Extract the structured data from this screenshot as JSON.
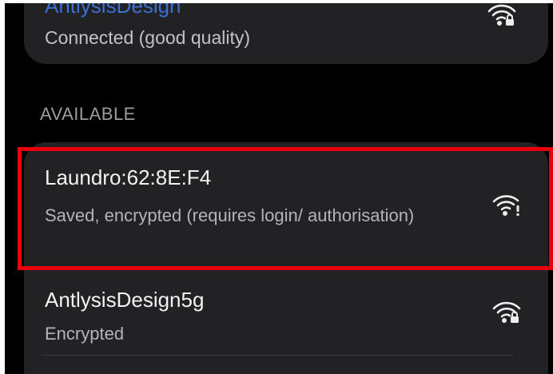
{
  "connected_network": {
    "name": "AntlysisDesign",
    "status": "Connected (good quality)",
    "icon": "wifi-lock-icon"
  },
  "available_section": {
    "label": "AVAILABLE"
  },
  "networks": [
    {
      "name": "Laundro:62:8E:F4",
      "status": "Saved, encrypted (requires login/ authorisation)",
      "icon": "wifi-alert-icon",
      "highlighted": true
    },
    {
      "name": "AntlysisDesign5g",
      "status": "Encrypted",
      "icon": "wifi-lock-icon",
      "highlighted": false
    }
  ],
  "colors": {
    "background": "#000000",
    "card": "#222224",
    "highlight_border": "#e8000b",
    "connected_name": "#3b6fd0"
  }
}
